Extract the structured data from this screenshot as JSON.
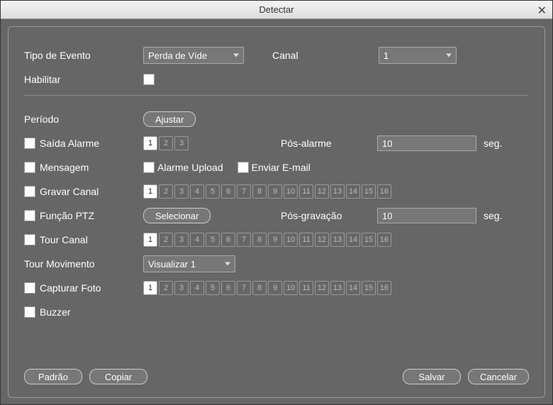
{
  "window": {
    "title": "Detectar"
  },
  "labels": {
    "tipo_evento": "Tipo de Evento",
    "canal": "Canal",
    "habilitar": "Habilitar",
    "periodo": "Período",
    "saida_alarme": "Saída Alarme",
    "pos_alarme": "Pós-alarme",
    "mensagem": "Mensagem",
    "alarme_upload": "Alarme Upload",
    "enviar_email": "Enviar E-mail",
    "gravar_canal": "Gravar Canal",
    "funcao_ptz": "Função PTZ",
    "pos_gravacao": "Pós-gravação",
    "tour_canal": "Tour Canal",
    "tour_movimento": "Tour Movimento",
    "capturar_foto": "Capturar Foto",
    "buzzer": "Buzzer",
    "seg": "seg."
  },
  "values": {
    "tipo_evento": "Perda de Víde",
    "canal": "1",
    "pos_alarme": "10",
    "pos_gravacao": "10",
    "tour_movimento": "Visualizar 1"
  },
  "buttons": {
    "ajustar": "Ajustar",
    "selecionar": "Selecionar",
    "padrao": "Padrão",
    "copiar": "Copiar",
    "salvar": "Salvar",
    "cancelar": "Cancelar"
  },
  "alarm_outputs": [
    "1",
    "2",
    "3"
  ],
  "channels": [
    "1",
    "2",
    "3",
    "4",
    "5",
    "6",
    "7",
    "8",
    "9",
    "10",
    "11",
    "12",
    "13",
    "14",
    "15",
    "16"
  ]
}
